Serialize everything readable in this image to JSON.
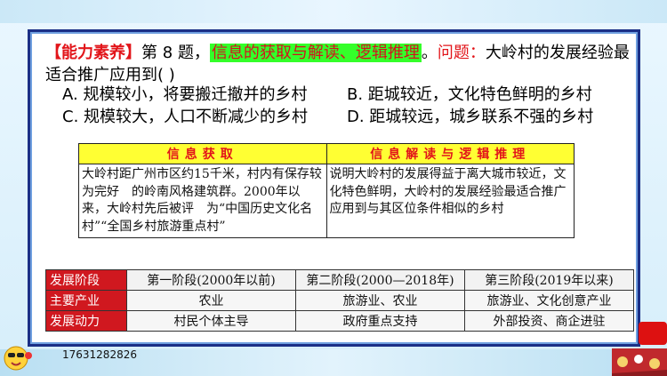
{
  "question": {
    "tag": "【能力素养】",
    "prefix": "第 8 题，",
    "highlight": "信息的获取与解读、逻辑推理",
    "dot": "。",
    "problem_label": "问题：",
    "text": "大岭村的发展经验最适合推广应用到(  )"
  },
  "options": [
    {
      "label": "A. 规模较小，将要搬迁撤并的乡村"
    },
    {
      "label": "B. 距城较近，文化特色鲜明的乡村"
    },
    {
      "label": "C. 规模较大，人口不断减少的乡村"
    },
    {
      "label": "D.  距城较远，城乡联系不强的乡村"
    }
  ],
  "info_table": {
    "header_left": "信息获取",
    "header_right": "信息解读与逻辑推理",
    "left": "大岭村距广州市区约15千米，村内有保存较为完好　的岭南风格建筑群。2000年以来，大岭村先后被评　为“中国历史文化名村”“全国乡村旅游重点村”",
    "right": "说明大岭村的发展得益于离大城市较近，文化特色鲜明，大岭村的发展经验最适合推广应用到与其区位条件相似的乡村"
  },
  "stage_table": {
    "rows": [
      {
        "head": "发展阶段",
        "cells": [
          "第一阶段(2000年以前)",
          "第二阶段(2000—2018年)",
          "第三阶段(2019年以来)"
        ]
      },
      {
        "head": "主要产业",
        "cells": [
          "农业",
          "旅游业、农业",
          "旅游业、文化创意产业"
        ]
      },
      {
        "head": "发展动力",
        "cells": [
          "村民个体主导",
          "政府重点支持",
          "外部投资、商企进驻"
        ]
      }
    ]
  },
  "footer": {
    "phone": "17631282826"
  },
  "colors": {
    "frame": "#1b2f86",
    "accent_red": "#e2151a",
    "highlight_green": "#34ff2a",
    "header_yellow": "#ffff33"
  }
}
